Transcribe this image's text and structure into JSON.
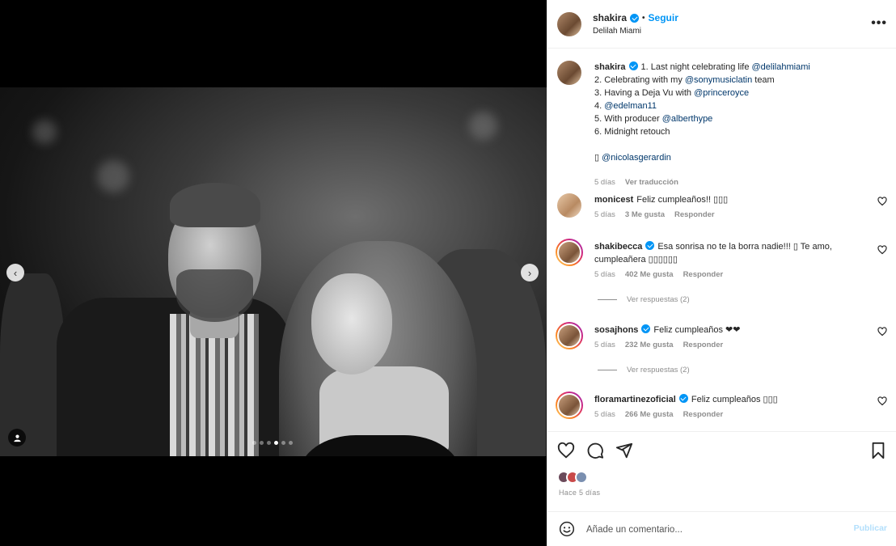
{
  "header": {
    "username": "shakira",
    "separator": "•",
    "follow_label": "Seguir",
    "location": "Delilah Miami",
    "more_label": "•••"
  },
  "caption": {
    "username": "shakira",
    "lines": [
      {
        "prefix": "1. Last night celebrating life ",
        "mention": "@delilahmiami",
        "suffix": ""
      },
      {
        "prefix": "2. Celebrating with my ",
        "mention": "@sonymusiclatin",
        "suffix": " team"
      },
      {
        "prefix": "3. Having a Deja Vu with ",
        "mention": "@princeroyce",
        "suffix": ""
      },
      {
        "prefix": "4. ",
        "mention": "@edelman11",
        "suffix": ""
      },
      {
        "prefix": "5. With producer ",
        "mention": "@alberthype",
        "suffix": ""
      },
      {
        "prefix": "6. Midnight retouch",
        "mention": "",
        "suffix": ""
      },
      {
        "prefix": "",
        "mention": "",
        "suffix": ""
      },
      {
        "prefix": "▯ ",
        "mention": "@nicolasgerardin",
        "suffix": ""
      }
    ],
    "time": "5 días",
    "translate": "Ver traducción"
  },
  "comments": [
    {
      "username": "monicest",
      "text": "Feliz cumpleaños!! ▯▯▯",
      "time": "5 días",
      "likes": "3 Me gusta",
      "reply": "Responder",
      "verified": false
    },
    {
      "username": "shakibecca",
      "text": "Esa sonrisa no te la borra nadie!!! ▯ Te amo, cumpleañera ▯▯▯▯▯▯",
      "time": "5 días",
      "likes": "402 Me gusta",
      "reply": "Responder",
      "verified": true,
      "view_replies": "Ver respuestas (2)"
    },
    {
      "username": "sosajhons",
      "text": "Feliz cumpleaños ❤❤",
      "time": "5 días",
      "likes": "232 Me gusta",
      "reply": "Responder",
      "verified": true,
      "view_replies": "Ver respuestas (2)"
    },
    {
      "username": "floramartinezoficial",
      "text": "Feliz cumpleaños ▯▯▯",
      "time": "5 días",
      "likes": "266 Me gusta",
      "reply": "Responder",
      "verified": true
    }
  ],
  "footer": {
    "time_ago": "Hace 5 días",
    "comment_placeholder": "Añade un comentario...",
    "publish_label": "Publicar"
  },
  "carousel": {
    "slide_count": 6,
    "active_index": 3
  },
  "icons": [
    "chevron-left-icon",
    "chevron-right-icon",
    "tag-user-icon",
    "heart-icon",
    "comment-icon",
    "share-icon",
    "bookmark-icon",
    "emoji-icon",
    "more-icon",
    "verified-icon"
  ],
  "colors": {
    "link": "#00376b",
    "accent": "#0095f6",
    "muted": "#8e8e8e"
  }
}
